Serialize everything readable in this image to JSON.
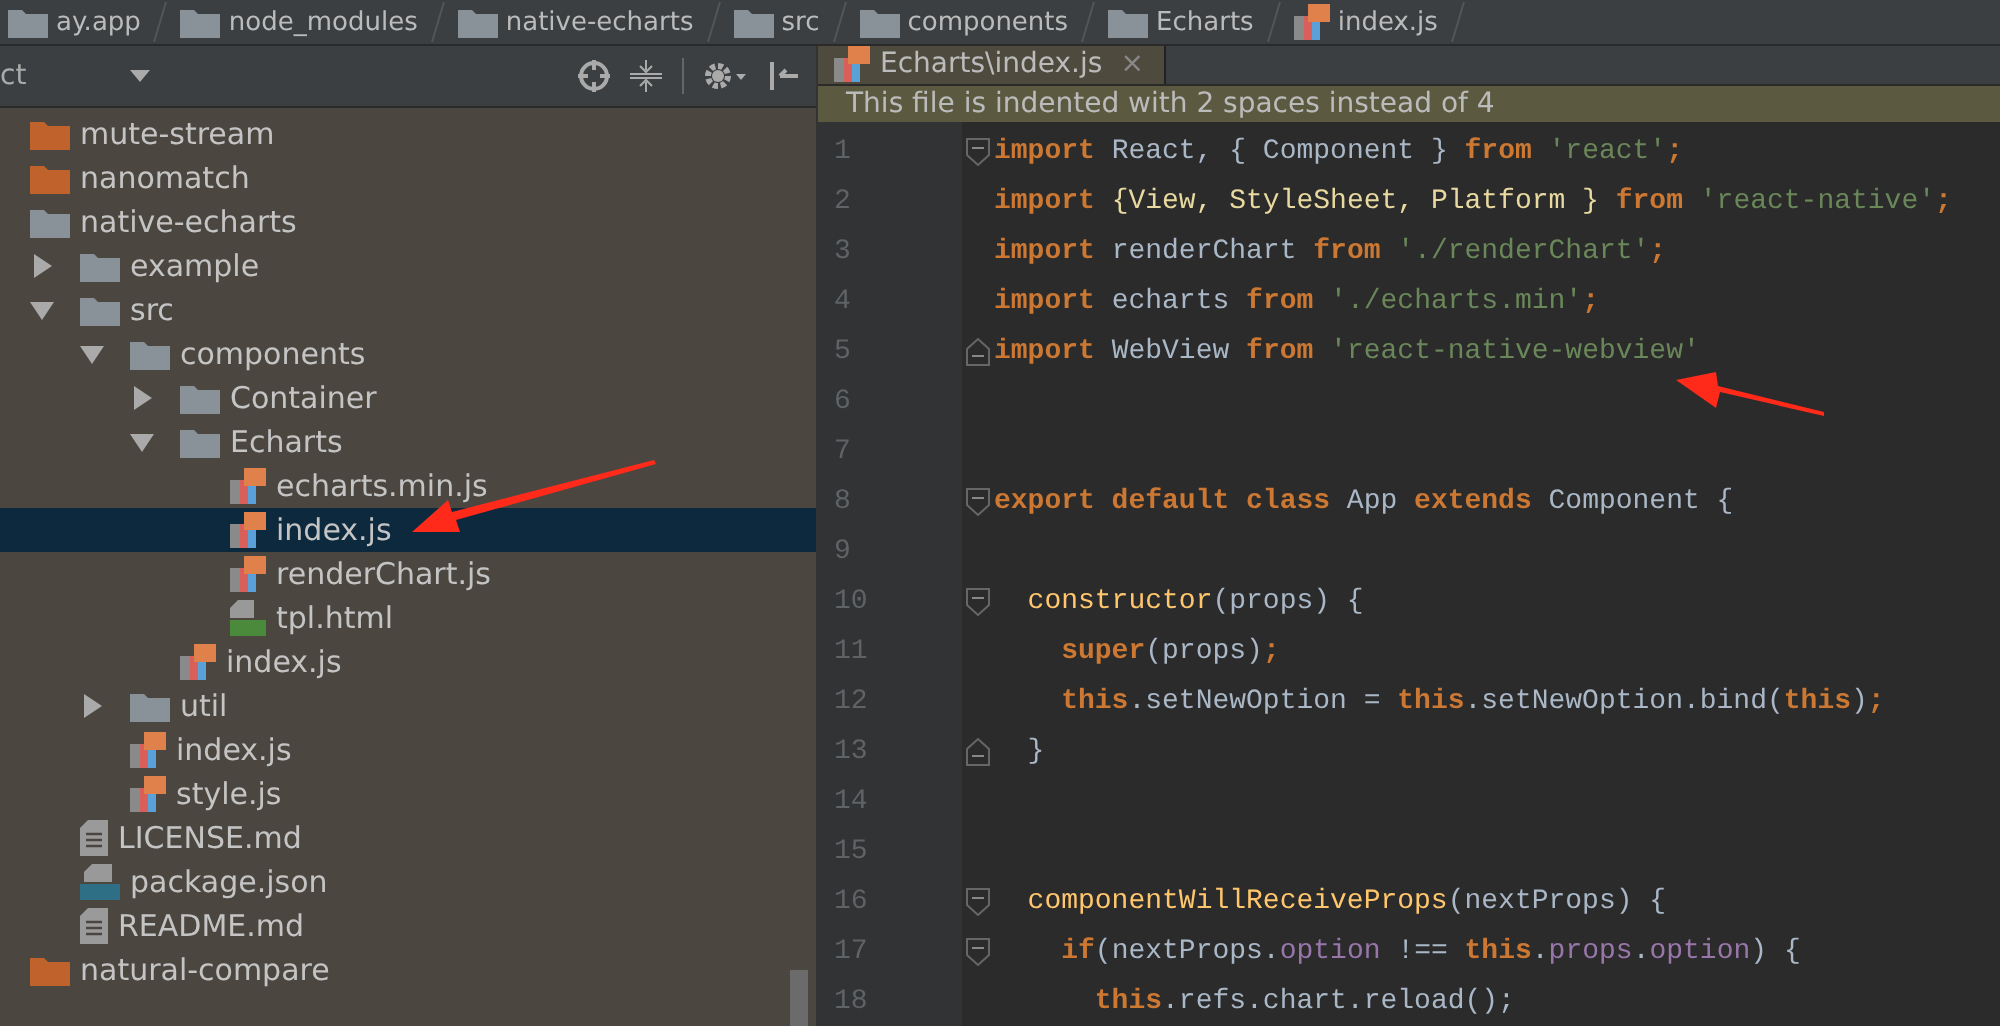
{
  "breadcrumbs": [
    {
      "kind": "folder",
      "label": "ay.app"
    },
    {
      "kind": "folder",
      "label": "node_modules"
    },
    {
      "kind": "folder",
      "label": "native-echarts"
    },
    {
      "kind": "folder",
      "label": "src"
    },
    {
      "kind": "folder",
      "label": "components"
    },
    {
      "kind": "folder",
      "label": "Echarts"
    },
    {
      "kind": "js",
      "label": "index.js"
    }
  ],
  "project_panel": {
    "title": "ct",
    "tree": [
      {
        "kind": "excluded",
        "label": "mute-stream",
        "selected": false
      },
      {
        "kind": "excluded",
        "label": "nanomatch",
        "selected": false
      },
      {
        "kind": "folder",
        "label": "native-echarts",
        "selected": false,
        "children": [
          {
            "kind": "folder",
            "label": "example",
            "selected": false,
            "expanded": false
          },
          {
            "kind": "folder",
            "label": "src",
            "selected": false,
            "expanded": true,
            "children": [
              {
                "kind": "folder",
                "label": "components",
                "selected": false,
                "expanded": true,
                "children": [
                  {
                    "kind": "folder",
                    "label": "Container",
                    "selected": false,
                    "expanded": false
                  },
                  {
                    "kind": "folder",
                    "label": "Echarts",
                    "selected": false,
                    "expanded": true,
                    "children": [
                      {
                        "kind": "js",
                        "label": "echarts.min.js",
                        "selected": false
                      },
                      {
                        "kind": "js",
                        "label": "index.js",
                        "selected": true
                      },
                      {
                        "kind": "js",
                        "label": "renderChart.js",
                        "selected": false
                      },
                      {
                        "kind": "html",
                        "label": "tpl.html",
                        "selected": false
                      }
                    ]
                  },
                  {
                    "kind": "js",
                    "label": "index.js",
                    "selected": false
                  }
                ]
              },
              {
                "kind": "folder",
                "label": "util",
                "selected": false,
                "expanded": false
              },
              {
                "kind": "js",
                "label": "index.js",
                "selected": false
              },
              {
                "kind": "js",
                "label": "style.js",
                "selected": false
              }
            ]
          },
          {
            "kind": "md",
            "label": "LICENSE.md",
            "selected": false
          },
          {
            "kind": "json",
            "label": "package.json",
            "selected": false
          },
          {
            "kind": "md",
            "label": "README.md",
            "selected": false
          }
        ]
      },
      {
        "kind": "excluded",
        "label": "natural-compare",
        "selected": false
      }
    ]
  },
  "editor": {
    "tabs": [
      {
        "label": "Echarts\\index.js",
        "close": "×",
        "selected": true
      }
    ],
    "notice": "This file is indented with 2 spaces instead of 4",
    "lines": [
      {
        "n": "1",
        "kind": "fold-start",
        "tokens": [
          {
            "kind": "kw",
            "text": "import"
          },
          {
            "kind": "id",
            "text": " React, { Component } "
          },
          {
            "kind": "kw",
            "text": "from"
          },
          {
            "kind": "str",
            "text": " 'react'"
          },
          {
            "kind": "kw",
            "text": ";"
          }
        ]
      },
      {
        "n": "2",
        "kind": "plain",
        "tokens": [
          {
            "kind": "kw",
            "text": "import"
          },
          {
            "kind": "cls",
            "text": " {View, StyleSheet, Platform } "
          },
          {
            "kind": "kw",
            "text": "from"
          },
          {
            "kind": "str",
            "text": " 'react-native'"
          },
          {
            "kind": "kw",
            "text": ";"
          }
        ]
      },
      {
        "n": "3",
        "kind": "plain",
        "tokens": [
          {
            "kind": "kw",
            "text": "import"
          },
          {
            "kind": "id",
            "text": " renderChart "
          },
          {
            "kind": "kw",
            "text": "from"
          },
          {
            "kind": "str",
            "text": " './renderChart'"
          },
          {
            "kind": "kw",
            "text": ";"
          }
        ]
      },
      {
        "n": "4",
        "kind": "plain",
        "tokens": [
          {
            "kind": "kw",
            "text": "import"
          },
          {
            "kind": "id",
            "text": " echarts "
          },
          {
            "kind": "kw",
            "text": "from"
          },
          {
            "kind": "str",
            "text": " './echarts.min'"
          },
          {
            "kind": "kw",
            "text": ";"
          }
        ]
      },
      {
        "n": "5",
        "kind": "fold-end",
        "tokens": [
          {
            "kind": "kw",
            "text": "import"
          },
          {
            "kind": "id",
            "text": " WebView "
          },
          {
            "kind": "kw",
            "text": "from"
          },
          {
            "kind": "str",
            "text": " 'react-native-webview'"
          }
        ]
      },
      {
        "n": "6",
        "kind": "plain"
      },
      {
        "n": "7",
        "kind": "plain"
      },
      {
        "n": "8",
        "kind": "fold-start",
        "tokens": [
          {
            "kind": "kw",
            "text": "export default class"
          },
          {
            "kind": "id",
            "text": " App "
          },
          {
            "kind": "kw",
            "text": "extends"
          },
          {
            "kind": "id",
            "text": " Component {"
          }
        ]
      },
      {
        "n": "9",
        "kind": "plain"
      },
      {
        "n": "10",
        "kind": "fold-start",
        "tokens": [
          {
            "kind": "fn",
            "text": "  constructor"
          },
          {
            "kind": "id",
            "text": "(props) {"
          }
        ]
      },
      {
        "n": "11",
        "kind": "plain",
        "tokens": [
          {
            "kind": "kw",
            "text": "    super"
          },
          {
            "kind": "id",
            "text": "(props)"
          },
          {
            "kind": "kw",
            "text": ";"
          }
        ]
      },
      {
        "n": "12",
        "kind": "plain",
        "tokens": [
          {
            "kind": "kw",
            "text": "    this"
          },
          {
            "kind": "id",
            "text": ".setNewOption = "
          },
          {
            "kind": "kw",
            "text": "this"
          },
          {
            "kind": "id",
            "text": ".setNewOption.bind("
          },
          {
            "kind": "kw",
            "text": "this"
          },
          {
            "kind": "id",
            "text": ")"
          },
          {
            "kind": "kw",
            "text": ";"
          }
        ]
      },
      {
        "n": "13",
        "kind": "fold-end",
        "tokens": [
          {
            "kind": "id",
            "text": "  }"
          }
        ]
      },
      {
        "n": "14",
        "kind": "plain"
      },
      {
        "n": "15",
        "kind": "plain"
      },
      {
        "n": "16",
        "kind": "fold-start",
        "tokens": [
          {
            "kind": "fn",
            "text": "  componentWillReceiveProps"
          },
          {
            "kind": "id",
            "text": "(nextProps) {"
          }
        ]
      },
      {
        "n": "17",
        "kind": "fold-start",
        "tokens": [
          {
            "kind": "kw",
            "text": "    if"
          },
          {
            "kind": "id",
            "text": "(nextProps."
          },
          {
            "kind": "fld",
            "text": "option"
          },
          {
            "kind": "id",
            "text": " !== "
          },
          {
            "kind": "kw",
            "text": "this"
          },
          {
            "kind": "id",
            "text": "."
          },
          {
            "kind": "fld",
            "text": "props"
          },
          {
            "kind": "id",
            "text": "."
          },
          {
            "kind": "fld",
            "text": "option"
          },
          {
            "kind": "id",
            "text": ") {"
          }
        ]
      },
      {
        "n": "18",
        "kind": "plain",
        "tokens": [
          {
            "kind": "kw",
            "text": "      this"
          },
          {
            "kind": "id",
            "text": ".refs.chart.reload();"
          }
        ]
      }
    ]
  }
}
